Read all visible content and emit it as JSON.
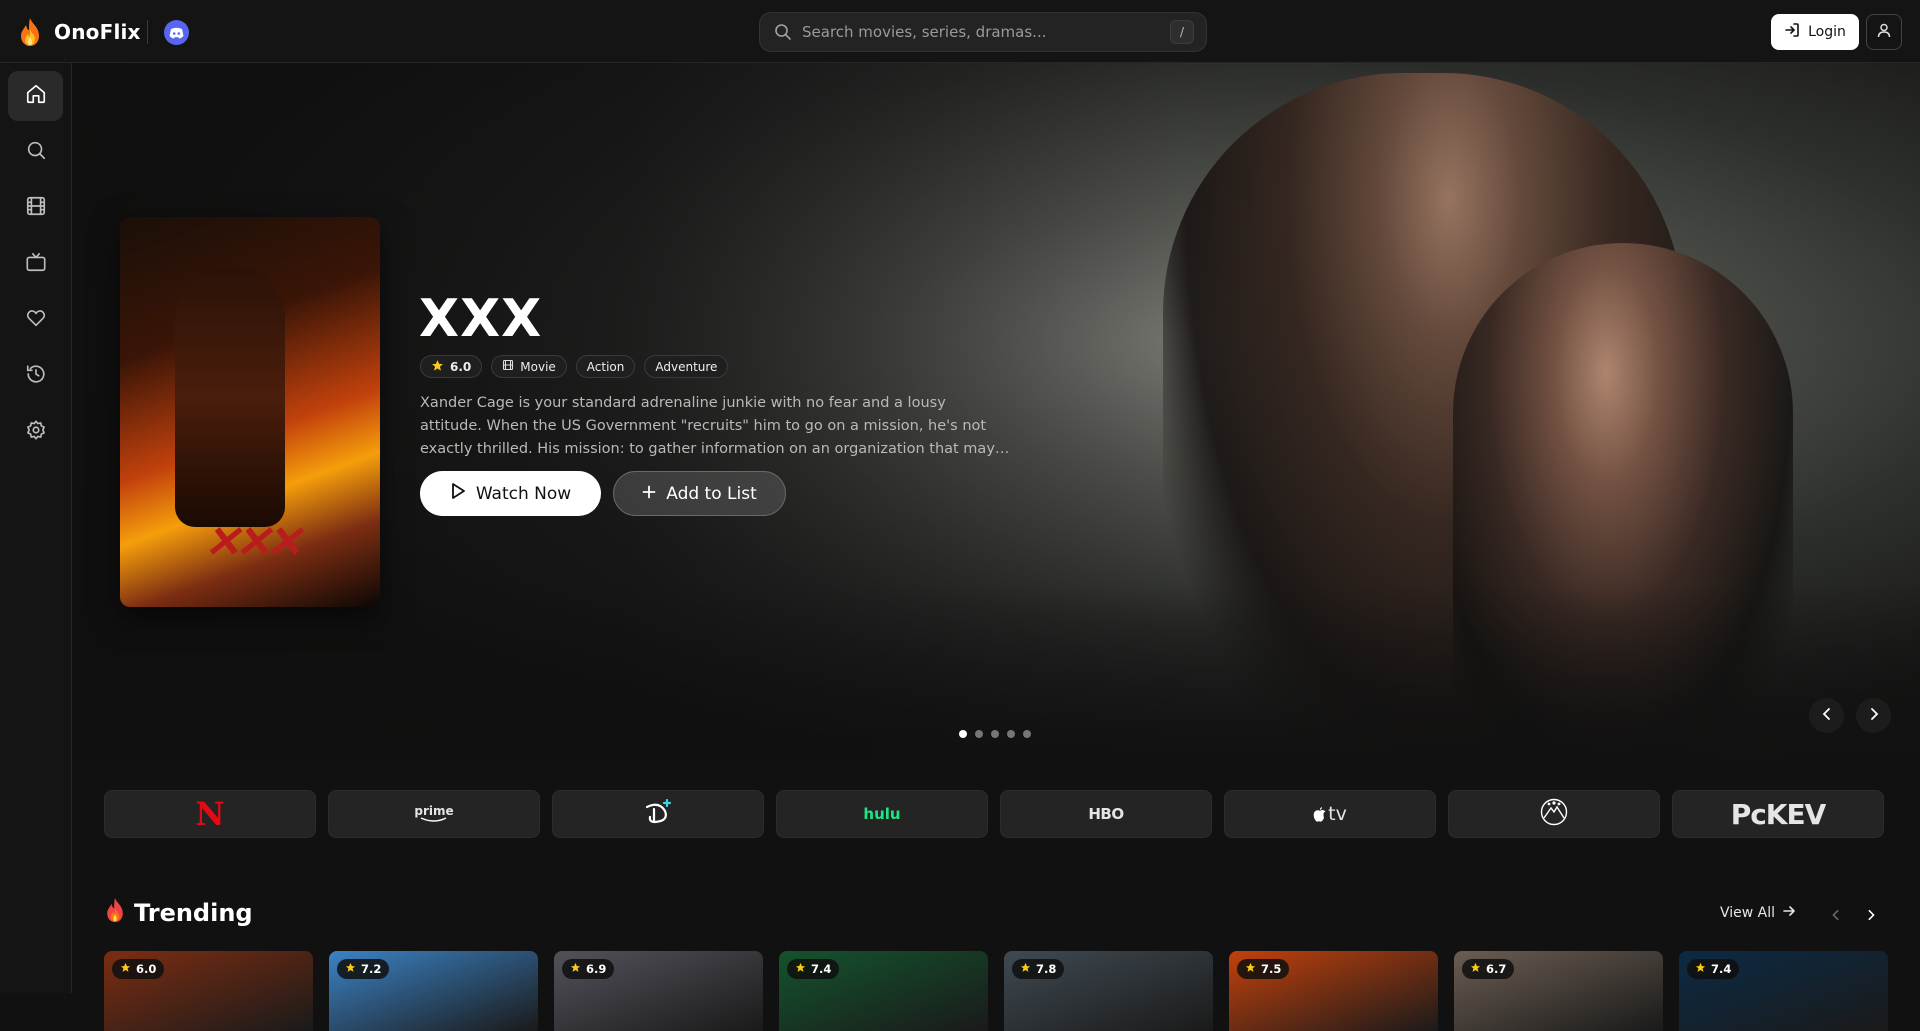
{
  "app": {
    "name": "OnoFlix"
  },
  "search": {
    "placeholder": "Search movies, series, dramas...",
    "shortcut": "/"
  },
  "header": {
    "login_label": "Login"
  },
  "sidebar": {
    "items": [
      {
        "name": "home",
        "icon": "home-icon",
        "active": true
      },
      {
        "name": "search",
        "icon": "search-icon",
        "active": false
      },
      {
        "name": "movies",
        "icon": "film-icon",
        "active": false
      },
      {
        "name": "tv",
        "icon": "tv-icon",
        "active": false
      },
      {
        "name": "favorites",
        "icon": "heart-icon",
        "active": false
      },
      {
        "name": "history",
        "icon": "history-icon",
        "active": false
      },
      {
        "name": "settings",
        "icon": "gear-icon",
        "active": false
      }
    ]
  },
  "hero": {
    "title": "XXX",
    "rating": "6.0",
    "type": "Movie",
    "genres": [
      "Action",
      "Adventure"
    ],
    "description": "Xander Cage is your standard adrenaline junkie with no fear and a lousy attitude. When the US Government \"recruits\" him to go on a mission, he's not exactly thrilled. His mission: to gather information on an organization that may just be planning the...",
    "watch_label": "Watch Now",
    "add_label": "Add to List",
    "slides": 5,
    "active_slide": 0
  },
  "providers": [
    {
      "name": "Netflix",
      "label": "N",
      "color": "#e50914"
    },
    {
      "name": "Prime Video",
      "label": "prime",
      "color": "#ffffff"
    },
    {
      "name": "Disney+",
      "label": "D+",
      "color": "#ffffff"
    },
    {
      "name": "Hulu",
      "label": "hulu",
      "color": "#1ce783"
    },
    {
      "name": "HBO",
      "label": "HBO",
      "color": "#ffffff"
    },
    {
      "name": "Apple TV",
      "label": "tv",
      "color": "#ffffff"
    },
    {
      "name": "Paramount",
      "label": "",
      "color": "#ffffff"
    },
    {
      "name": "Peacock",
      "label": "PcKEV",
      "color": "#ffffff"
    }
  ],
  "trending": {
    "title": "Trending",
    "view_all": "View All",
    "items": [
      {
        "rating": "6.0",
        "color": "#7c2d12"
      },
      {
        "rating": "7.2",
        "color": "#3b82c4"
      },
      {
        "rating": "6.9",
        "color": "#52525b"
      },
      {
        "rating": "7.4",
        "color": "#14532d"
      },
      {
        "rating": "7.8",
        "color": "#3f4a52"
      },
      {
        "rating": "7.5",
        "color": "#c2410c"
      },
      {
        "rating": "6.7",
        "color": "#6b5d52"
      },
      {
        "rating": "7.4",
        "color": "#0c2a44"
      }
    ]
  },
  "colors": {
    "accent_flame": "#f97316",
    "discord": "#5865f2",
    "star": "#facc15"
  }
}
